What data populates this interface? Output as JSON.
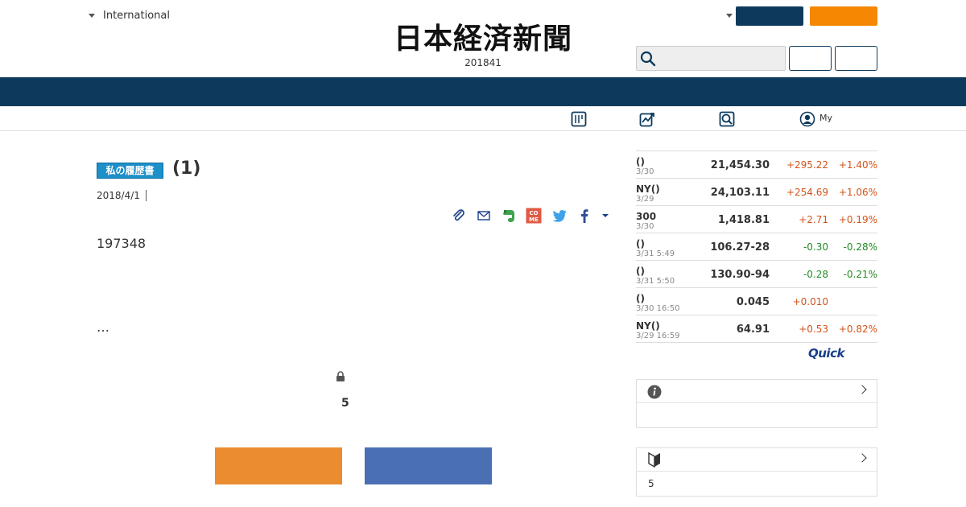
{
  "header": {
    "edition_label": "International",
    "masthead": "日本経済新聞",
    "date": "201841"
  },
  "subnav": {
    "my_label": "My"
  },
  "article": {
    "series_badge": "私の履歴書",
    "title": "(1)",
    "date": "2018/4/1",
    "lead": "197348",
    "ellipsis": "…",
    "paywall_number": "5"
  },
  "market": {
    "rows": [
      {
        "name": "()",
        "time": "3/30",
        "value": "21,454.30",
        "change": "+295.22",
        "pct": "+1.40%",
        "direction": "up"
      },
      {
        "name": "NY()",
        "time": "3/29",
        "value": "24,103.11",
        "change": "+254.69",
        "pct": "+1.06%",
        "direction": "up"
      },
      {
        "name": "300",
        "time": "3/30",
        "value": "1,418.81",
        "change": "+2.71",
        "pct": "+0.19%",
        "direction": "up"
      },
      {
        "name": "()",
        "time": "3/31 5:49",
        "value": "106.27-28",
        "change": "-0.30",
        "pct": "-0.28%",
        "direction": "down"
      },
      {
        "name": "()",
        "time": "3/31 5:50",
        "value": "130.90-94",
        "change": "-0.28",
        "pct": "-0.21%",
        "direction": "down"
      },
      {
        "name": "()",
        "time": "3/30 16:50",
        "value": "0.045",
        "change": "+0.010",
        "pct": "",
        "direction": "up"
      },
      {
        "name": "NY()",
        "time": "3/29 16:59",
        "value": "64.91",
        "change": "+0.53",
        "pct": "+0.82%",
        "direction": "up"
      }
    ],
    "source_logo": "Quick"
  },
  "boxes": {
    "box2_body": "5"
  },
  "colors": {
    "navy": "#0d3a5c",
    "orange": "#f58703",
    "up": "#d2531a",
    "down": "#228b22"
  }
}
